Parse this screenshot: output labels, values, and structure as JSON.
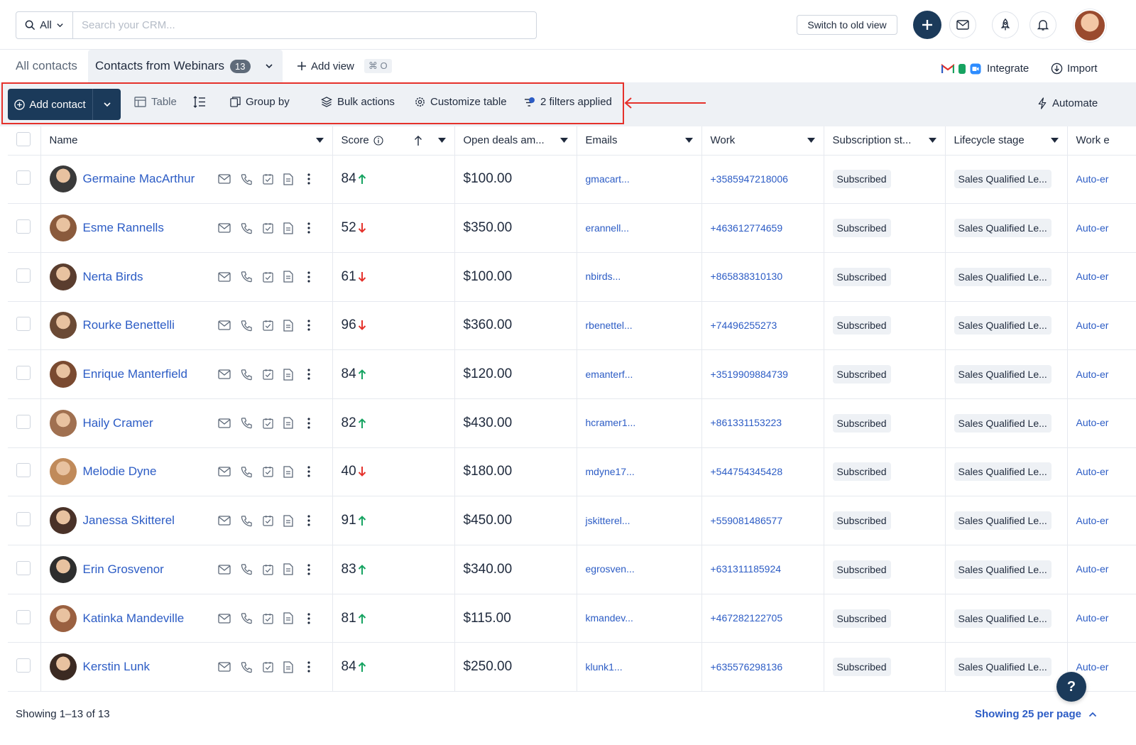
{
  "search": {
    "scope_label": "All",
    "placeholder": "Search your CRM..."
  },
  "header": {
    "old_view_label": "Switch to old view"
  },
  "views": {
    "all_label": "All contacts",
    "active_label": "Contacts from Webinars",
    "active_count": "13",
    "add_view_label": "Add view",
    "add_view_shortcut": "⌘ O",
    "integrate_label": "Integrate",
    "import_label": "Import"
  },
  "toolbar": {
    "add_contact_label": "Add contact",
    "table_label": "Table",
    "group_by_label": "Group by",
    "bulk_actions_label": "Bulk actions",
    "customize_label": "Customize table",
    "filters_label": "2 filters applied",
    "automate_label": "Automate"
  },
  "columns": {
    "name": "Name",
    "score": "Score",
    "deals": "Open deals am...",
    "emails": "Emails",
    "work": "Work",
    "subscription": "Subscription st...",
    "lifecycle": "Lifecycle stage",
    "work_email": "Work e"
  },
  "rows": [
    {
      "name": "Germaine MacArthur",
      "score": "84",
      "trend": "up",
      "deal": "$100.00",
      "email": "gmacart...",
      "phone": "+3585947218006",
      "subscription": "Subscribed",
      "lifecycle": "Sales Qualified Le...",
      "work_email": "Auto-er"
    },
    {
      "name": "Esme Rannells",
      "score": "52",
      "trend": "down",
      "deal": "$350.00",
      "email": "erannell...",
      "phone": "+463612774659",
      "subscription": "Subscribed",
      "lifecycle": "Sales Qualified Le...",
      "work_email": "Auto-er"
    },
    {
      "name": "Nerta Birds",
      "score": "61",
      "trend": "down",
      "deal": "$100.00",
      "email": "nbirds...",
      "phone": "+865838310130",
      "subscription": "Subscribed",
      "lifecycle": "Sales Qualified Le...",
      "work_email": "Auto-er"
    },
    {
      "name": "Rourke Benettelli",
      "score": "96",
      "trend": "down",
      "deal": "$360.00",
      "email": "rbenettel...",
      "phone": "+74496255273",
      "subscription": "Subscribed",
      "lifecycle": "Sales Qualified Le...",
      "work_email": "Auto-er"
    },
    {
      "name": "Enrique Manterfield",
      "score": "84",
      "trend": "up",
      "deal": "$120.00",
      "email": "emanterf...",
      "phone": "+3519909884739",
      "subscription": "Subscribed",
      "lifecycle": "Sales Qualified Le...",
      "work_email": "Auto-er"
    },
    {
      "name": "Haily Cramer",
      "score": "82",
      "trend": "up",
      "deal": "$430.00",
      "email": "hcramer1...",
      "phone": "+861331153223",
      "subscription": "Subscribed",
      "lifecycle": "Sales Qualified Le...",
      "work_email": "Auto-er"
    },
    {
      "name": "Melodie Dyne",
      "score": "40",
      "trend": "down",
      "deal": "$180.00",
      "email": "mdyne17...",
      "phone": "+544754345428",
      "subscription": "Subscribed",
      "lifecycle": "Sales Qualified Le...",
      "work_email": "Auto-er"
    },
    {
      "name": "Janessa Skitterel",
      "score": "91",
      "trend": "up",
      "deal": "$450.00",
      "email": "jskitterel...",
      "phone": "+559081486577",
      "subscription": "Subscribed",
      "lifecycle": "Sales Qualified Le...",
      "work_email": "Auto-er"
    },
    {
      "name": "Erin Grosvenor",
      "score": "83",
      "trend": "up",
      "deal": "$340.00",
      "email": "egrosven...",
      "phone": "+631311185924",
      "subscription": "Subscribed",
      "lifecycle": "Sales Qualified Le...",
      "work_email": "Auto-er"
    },
    {
      "name": "Katinka Mandeville",
      "score": "81",
      "trend": "up",
      "deal": "$115.00",
      "email": "kmandev...",
      "phone": "+467282122705",
      "subscription": "Subscribed",
      "lifecycle": "Sales Qualified Le...",
      "work_email": "Auto-er"
    },
    {
      "name": "Kerstin Lunk",
      "score": "84",
      "trend": "up",
      "deal": "$250.00",
      "email": "klunk1...",
      "phone": "+635576298136",
      "subscription": "Subscribed",
      "lifecycle": "Sales Qualified Le...",
      "work_email": "Auto-er"
    }
  ],
  "footer": {
    "showing_label": "Showing 1–13 of 13",
    "per_page_label": "Showing 25 per page"
  },
  "help_label": "?",
  "colors": {
    "primary": "#1b3a5a",
    "link": "#2c5cc5",
    "up": "#16a361",
    "down": "#e5312b",
    "highlight": "#e5312b"
  }
}
